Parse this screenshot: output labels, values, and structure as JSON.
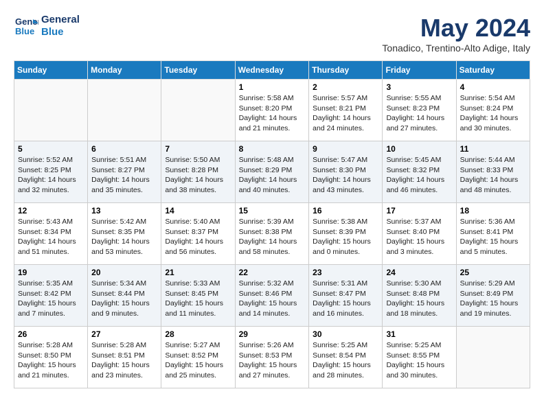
{
  "header": {
    "logo_line1": "General",
    "logo_line2": "Blue",
    "month": "May 2024",
    "location": "Tonadico, Trentino-Alto Adige, Italy"
  },
  "days_of_week": [
    "Sunday",
    "Monday",
    "Tuesday",
    "Wednesday",
    "Thursday",
    "Friday",
    "Saturday"
  ],
  "weeks": [
    [
      {
        "num": "",
        "info": ""
      },
      {
        "num": "",
        "info": ""
      },
      {
        "num": "",
        "info": ""
      },
      {
        "num": "1",
        "info": "Sunrise: 5:58 AM\nSunset: 8:20 PM\nDaylight: 14 hours\nand 21 minutes."
      },
      {
        "num": "2",
        "info": "Sunrise: 5:57 AM\nSunset: 8:21 PM\nDaylight: 14 hours\nand 24 minutes."
      },
      {
        "num": "3",
        "info": "Sunrise: 5:55 AM\nSunset: 8:23 PM\nDaylight: 14 hours\nand 27 minutes."
      },
      {
        "num": "4",
        "info": "Sunrise: 5:54 AM\nSunset: 8:24 PM\nDaylight: 14 hours\nand 30 minutes."
      }
    ],
    [
      {
        "num": "5",
        "info": "Sunrise: 5:52 AM\nSunset: 8:25 PM\nDaylight: 14 hours\nand 32 minutes."
      },
      {
        "num": "6",
        "info": "Sunrise: 5:51 AM\nSunset: 8:27 PM\nDaylight: 14 hours\nand 35 minutes."
      },
      {
        "num": "7",
        "info": "Sunrise: 5:50 AM\nSunset: 8:28 PM\nDaylight: 14 hours\nand 38 minutes."
      },
      {
        "num": "8",
        "info": "Sunrise: 5:48 AM\nSunset: 8:29 PM\nDaylight: 14 hours\nand 40 minutes."
      },
      {
        "num": "9",
        "info": "Sunrise: 5:47 AM\nSunset: 8:30 PM\nDaylight: 14 hours\nand 43 minutes."
      },
      {
        "num": "10",
        "info": "Sunrise: 5:45 AM\nSunset: 8:32 PM\nDaylight: 14 hours\nand 46 minutes."
      },
      {
        "num": "11",
        "info": "Sunrise: 5:44 AM\nSunset: 8:33 PM\nDaylight: 14 hours\nand 48 minutes."
      }
    ],
    [
      {
        "num": "12",
        "info": "Sunrise: 5:43 AM\nSunset: 8:34 PM\nDaylight: 14 hours\nand 51 minutes."
      },
      {
        "num": "13",
        "info": "Sunrise: 5:42 AM\nSunset: 8:35 PM\nDaylight: 14 hours\nand 53 minutes."
      },
      {
        "num": "14",
        "info": "Sunrise: 5:40 AM\nSunset: 8:37 PM\nDaylight: 14 hours\nand 56 minutes."
      },
      {
        "num": "15",
        "info": "Sunrise: 5:39 AM\nSunset: 8:38 PM\nDaylight: 14 hours\nand 58 minutes."
      },
      {
        "num": "16",
        "info": "Sunrise: 5:38 AM\nSunset: 8:39 PM\nDaylight: 15 hours\nand 0 minutes."
      },
      {
        "num": "17",
        "info": "Sunrise: 5:37 AM\nSunset: 8:40 PM\nDaylight: 15 hours\nand 3 minutes."
      },
      {
        "num": "18",
        "info": "Sunrise: 5:36 AM\nSunset: 8:41 PM\nDaylight: 15 hours\nand 5 minutes."
      }
    ],
    [
      {
        "num": "19",
        "info": "Sunrise: 5:35 AM\nSunset: 8:42 PM\nDaylight: 15 hours\nand 7 minutes."
      },
      {
        "num": "20",
        "info": "Sunrise: 5:34 AM\nSunset: 8:44 PM\nDaylight: 15 hours\nand 9 minutes."
      },
      {
        "num": "21",
        "info": "Sunrise: 5:33 AM\nSunset: 8:45 PM\nDaylight: 15 hours\nand 11 minutes."
      },
      {
        "num": "22",
        "info": "Sunrise: 5:32 AM\nSunset: 8:46 PM\nDaylight: 15 hours\nand 14 minutes."
      },
      {
        "num": "23",
        "info": "Sunrise: 5:31 AM\nSunset: 8:47 PM\nDaylight: 15 hours\nand 16 minutes."
      },
      {
        "num": "24",
        "info": "Sunrise: 5:30 AM\nSunset: 8:48 PM\nDaylight: 15 hours\nand 18 minutes."
      },
      {
        "num": "25",
        "info": "Sunrise: 5:29 AM\nSunset: 8:49 PM\nDaylight: 15 hours\nand 19 minutes."
      }
    ],
    [
      {
        "num": "26",
        "info": "Sunrise: 5:28 AM\nSunset: 8:50 PM\nDaylight: 15 hours\nand 21 minutes."
      },
      {
        "num": "27",
        "info": "Sunrise: 5:28 AM\nSunset: 8:51 PM\nDaylight: 15 hours\nand 23 minutes."
      },
      {
        "num": "28",
        "info": "Sunrise: 5:27 AM\nSunset: 8:52 PM\nDaylight: 15 hours\nand 25 minutes."
      },
      {
        "num": "29",
        "info": "Sunrise: 5:26 AM\nSunset: 8:53 PM\nDaylight: 15 hours\nand 27 minutes."
      },
      {
        "num": "30",
        "info": "Sunrise: 5:25 AM\nSunset: 8:54 PM\nDaylight: 15 hours\nand 28 minutes."
      },
      {
        "num": "31",
        "info": "Sunrise: 5:25 AM\nSunset: 8:55 PM\nDaylight: 15 hours\nand 30 minutes."
      },
      {
        "num": "",
        "info": ""
      }
    ]
  ]
}
